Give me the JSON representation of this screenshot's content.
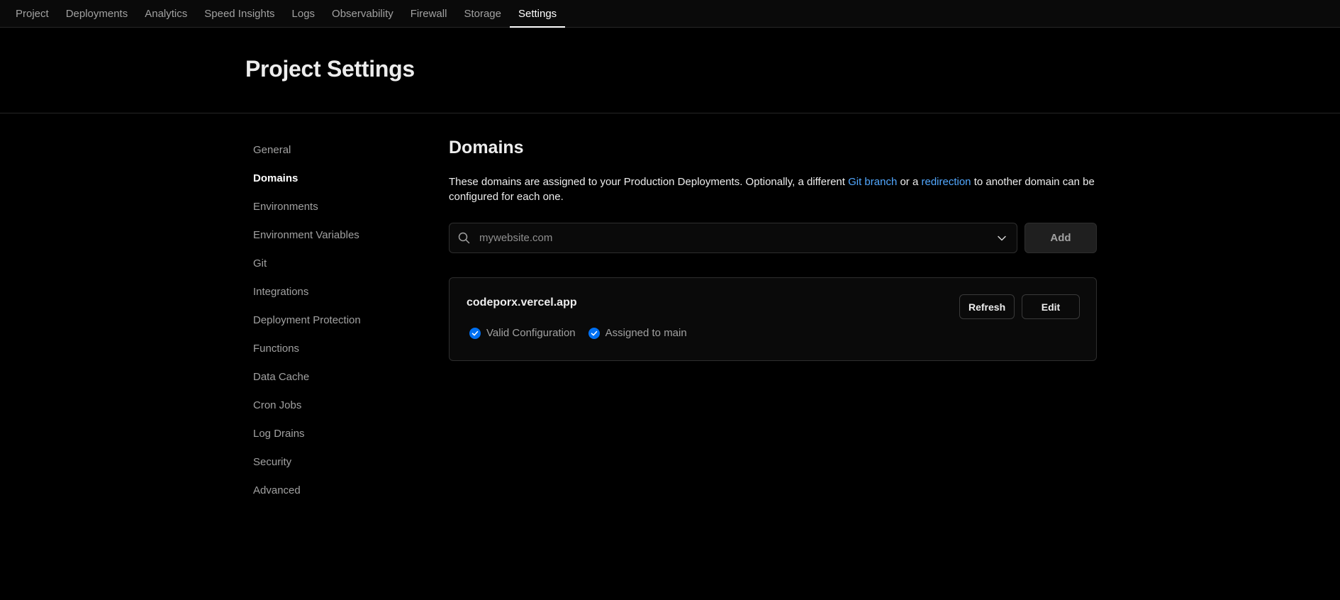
{
  "nav": {
    "tabs": [
      {
        "label": "Project"
      },
      {
        "label": "Deployments"
      },
      {
        "label": "Analytics"
      },
      {
        "label": "Speed Insights"
      },
      {
        "label": "Logs"
      },
      {
        "label": "Observability"
      },
      {
        "label": "Firewall"
      },
      {
        "label": "Storage"
      },
      {
        "label": "Settings",
        "active": true
      }
    ]
  },
  "header": {
    "title": "Project Settings"
  },
  "sidebar": {
    "items": [
      {
        "label": "General"
      },
      {
        "label": "Domains",
        "active": true
      },
      {
        "label": "Environments"
      },
      {
        "label": "Environment Variables"
      },
      {
        "label": "Git"
      },
      {
        "label": "Integrations"
      },
      {
        "label": "Deployment Protection"
      },
      {
        "label": "Functions"
      },
      {
        "label": "Data Cache"
      },
      {
        "label": "Cron Jobs"
      },
      {
        "label": "Log Drains"
      },
      {
        "label": "Security"
      },
      {
        "label": "Advanced"
      }
    ]
  },
  "main": {
    "title": "Domains",
    "description": {
      "part1": "These domains are assigned to your Production Deployments. Optionally, a different ",
      "link1": "Git branch",
      "part2": " or a ",
      "link2": "redirection",
      "part3": " to another domain can be configured for each one."
    },
    "domain_input": {
      "placeholder": "mywebsite.com",
      "value": ""
    },
    "add_label": "Add",
    "domain_card": {
      "domain": "codeporx.vercel.app",
      "refresh_label": "Refresh",
      "edit_label": "Edit",
      "statuses": [
        {
          "label": "Valid Configuration"
        },
        {
          "label": "Assigned to main"
        }
      ]
    }
  },
  "colors": {
    "background": "#000000",
    "link": "#52a8ff",
    "check": "#0070f3"
  }
}
